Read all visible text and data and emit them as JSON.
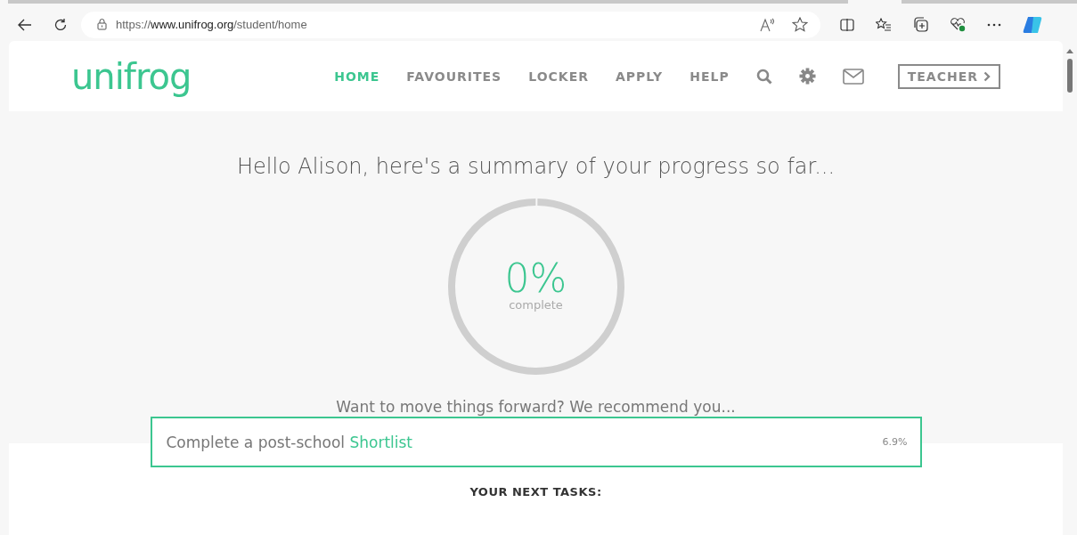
{
  "browser": {
    "address": {
      "scheme": "https://",
      "host": "www.unifrog.org",
      "path": "/student/home"
    }
  },
  "header": {
    "logo": "unifrog",
    "nav": [
      {
        "label": "HOME",
        "selected": true
      },
      {
        "label": "FAVOURITES",
        "selected": false
      },
      {
        "label": "LOCKER",
        "selected": false
      },
      {
        "label": "APPLY",
        "selected": false
      },
      {
        "label": "HELP",
        "selected": false
      }
    ],
    "teacher_button": "TEACHER"
  },
  "summary": {
    "greeting": "Hello Alison, here's a summary of your progress so far...",
    "progress": {
      "percent": "0%",
      "caption": "complete",
      "level": 0
    },
    "prompt": "Want to move things forward? We recommend you..."
  },
  "recommendation": {
    "text": "Complete a post-school ",
    "link": "Shortlist",
    "share": "6.9%"
  },
  "tasks_heading": "YOUR NEXT TASKS:"
}
